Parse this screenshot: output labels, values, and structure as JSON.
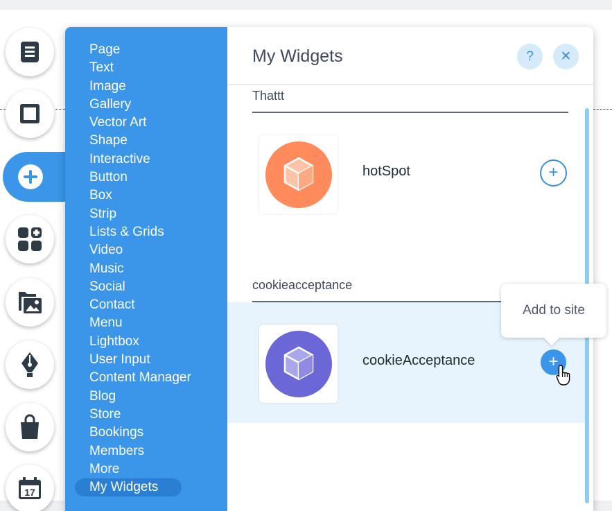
{
  "sidebar": {
    "categories": [
      "Page",
      "Text",
      "Image",
      "Gallery",
      "Vector Art",
      "Shape",
      "Interactive",
      "Button",
      "Box",
      "Strip",
      "Lists & Grids",
      "Video",
      "Music",
      "Social",
      "Contact",
      "Menu",
      "Lightbox",
      "User Input",
      "Content Manager",
      "Blog",
      "Store",
      "Bookings",
      "Members",
      "More"
    ],
    "selected": "My Widgets"
  },
  "rail": {
    "icons": [
      "pages-icon",
      "background-icon",
      "add-icon",
      "add-apps-icon",
      "media-icon",
      "design-pen-icon",
      "store-bag-icon",
      "calendar-icon"
    ],
    "calendar_day": "17"
  },
  "panel": {
    "title": "My Widgets",
    "help_label": "?",
    "close_label": "✕",
    "sections": [
      {
        "title": "Thattt",
        "widget": {
          "name": "hotSpot",
          "color": "#ff8a5c"
        }
      },
      {
        "title": "cookieacceptance",
        "widget": {
          "name": "cookieAcceptance",
          "color": "#6b67d6"
        }
      }
    ],
    "add_label": "+",
    "tooltip": "Add to site"
  },
  "colors": {
    "accent": "#3b95e8",
    "panel_dark": "#2a7fd3",
    "scroll": "#8ccbf5"
  }
}
